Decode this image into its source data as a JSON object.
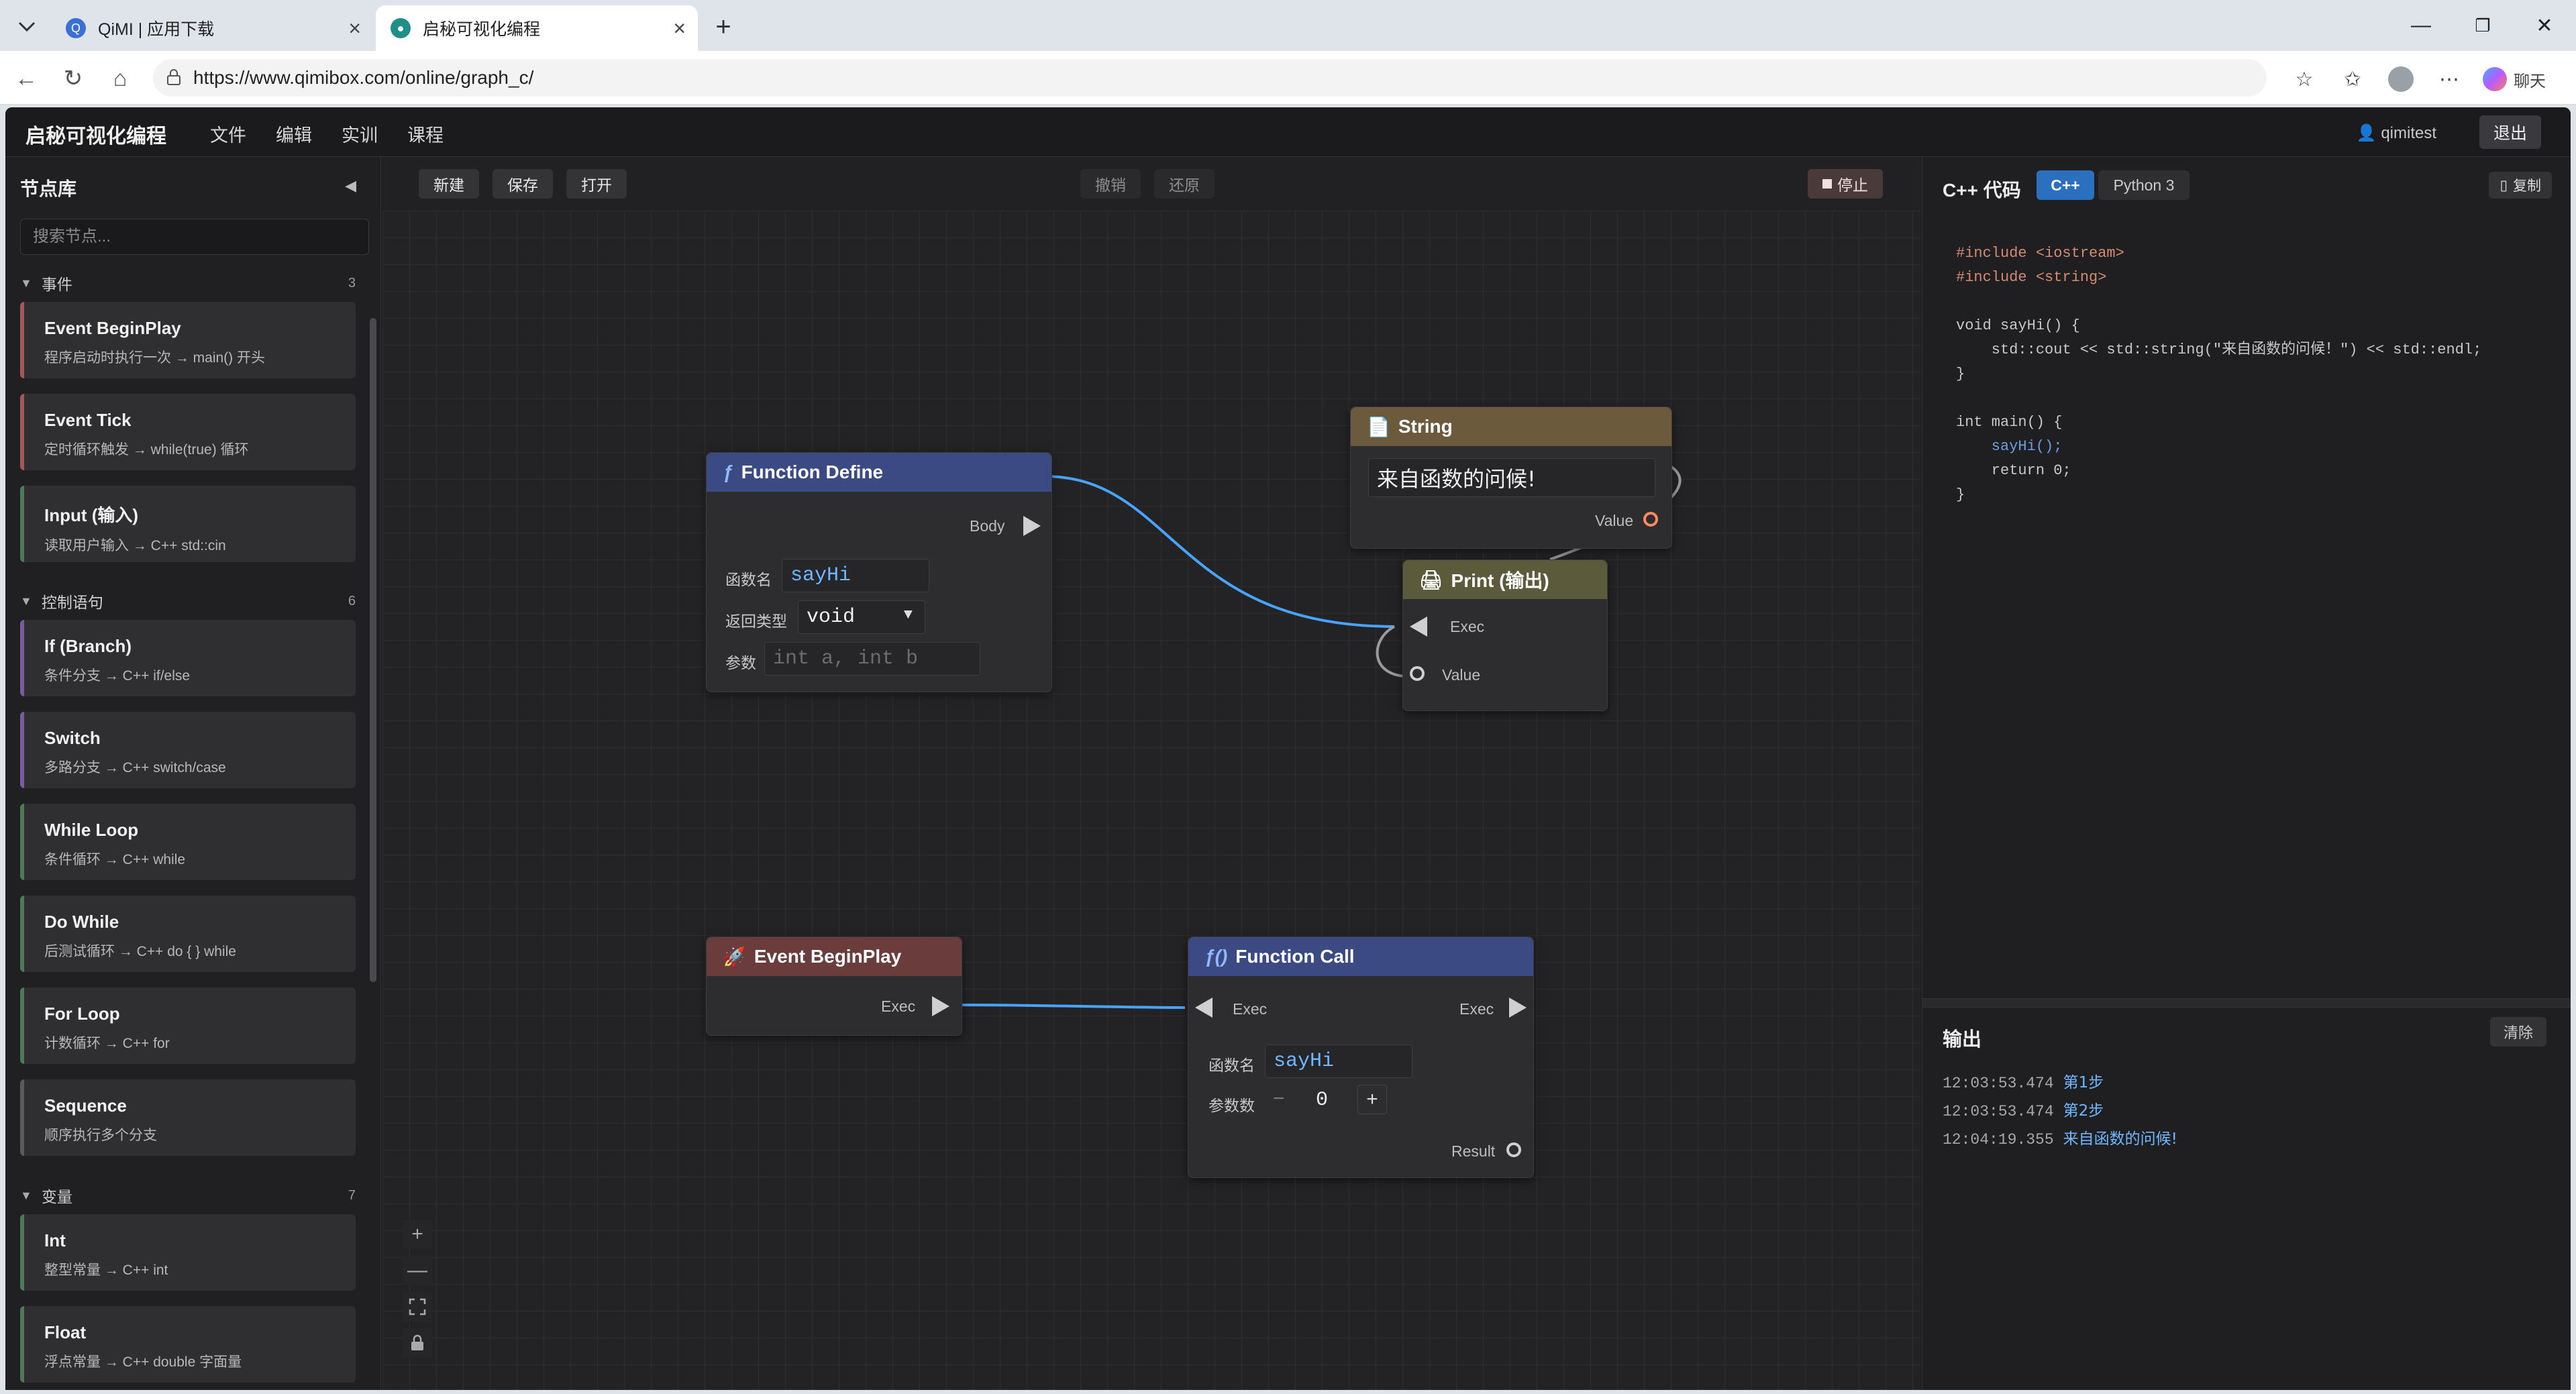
{
  "browser": {
    "tabs": [
      {
        "title": "QiMI | 应用下载",
        "active": false
      },
      {
        "title": "启秘可视化编程",
        "active": true
      }
    ],
    "url": "https://www.qimibox.com/online/graph_c/",
    "chat_label": "聊天"
  },
  "app": {
    "title": "启秘可视化编程",
    "menu": [
      "文件",
      "编辑",
      "实训",
      "课程"
    ],
    "user": "qimitest",
    "logout": "退出"
  },
  "sidebar": {
    "title": "节点库",
    "search_placeholder": "搜索节点...",
    "categories": [
      {
        "name": "事件",
        "count": "3",
        "items": [
          {
            "name": "Event BeginPlay",
            "desc": "程序启动时执行一次 → main() 开头"
          },
          {
            "name": "Event Tick",
            "desc": "定时循环触发 → while(true) 循环"
          },
          {
            "name": "Input (输入)",
            "desc": "读取用户输入 → C++ std::cin"
          }
        ]
      },
      {
        "name": "控制语句",
        "count": "6",
        "items": [
          {
            "name": "If (Branch)",
            "desc": "条件分支 → C++ if/else"
          },
          {
            "name": "Switch",
            "desc": "多路分支 → C++ switch/case"
          },
          {
            "name": "While Loop",
            "desc": "条件循环 → C++ while"
          },
          {
            "name": "Do While",
            "desc": "后测试循环 → C++ do { } while"
          },
          {
            "name": "For Loop",
            "desc": "计数循环 → C++ for"
          },
          {
            "name": "Sequence",
            "desc": "顺序执行多个分支"
          }
        ]
      },
      {
        "name": "变量",
        "count": "7",
        "items": [
          {
            "name": "Int",
            "desc": "整型常量 → C++ int"
          },
          {
            "name": "Float",
            "desc": "浮点常量 → C++ double 字面量"
          }
        ]
      }
    ]
  },
  "canvas": {
    "toolbar": {
      "new": "新建",
      "save": "保存",
      "open": "打开",
      "undo": "撤销",
      "redo": "还原",
      "stop": "停止"
    },
    "nodes": {
      "function_define": {
        "title": "Function Define",
        "icon": "ƒ",
        "body_label": "Body",
        "name_label": "函数名",
        "name_value": "sayHi",
        "return_label": "返回类型",
        "return_value": "void",
        "params_label": "参数",
        "params_placeholder": "int a, int b"
      },
      "string": {
        "title": "String",
        "value": "来自函数的问候!",
        "out_label": "Value"
      },
      "print": {
        "title": "Print (输出)",
        "exec_label": "Exec",
        "value_label": "Value"
      },
      "begin_play": {
        "title": "Event BeginPlay",
        "exec_label": "Exec"
      },
      "function_call": {
        "title": "Function Call",
        "icon": "ƒ()",
        "exec_in_label": "Exec",
        "exec_out_label": "Exec",
        "name_label": "函数名",
        "name_value": "sayHi",
        "argc_label": "参数数",
        "argc_value": "0",
        "result_label": "Result"
      }
    },
    "zoom": {
      "plus": "+",
      "minus": "—"
    }
  },
  "code_panel": {
    "title": "C++ 代码",
    "lang_cpp": "C++",
    "lang_py": "Python 3",
    "copy": "复制",
    "lines": [
      "#include <iostream>",
      "#include <string>",
      "",
      "void sayHi() {",
      "    std::cout << std::string(\"来自函数的问候！\") << std::endl;",
      "}",
      "",
      "int main() {",
      "    sayHi();",
      "    return 0;",
      "}"
    ]
  },
  "output": {
    "title": "输出",
    "clear": "清除",
    "logs": [
      {
        "time": "12:03:53.474",
        "msg": "第1步"
      },
      {
        "time": "12:03:53.474",
        "msg": "第2步"
      },
      {
        "time": "12:04:19.355",
        "msg": "来自函数的问候!"
      }
    ]
  },
  "colors": {
    "accent": "#2b6fbf",
    "wire": "#4aa3ff",
    "function_header": "#3b4a82",
    "string_header": "#6b5a3c",
    "print_header": "#5b5a3a",
    "event_header": "#6b3c3c"
  }
}
